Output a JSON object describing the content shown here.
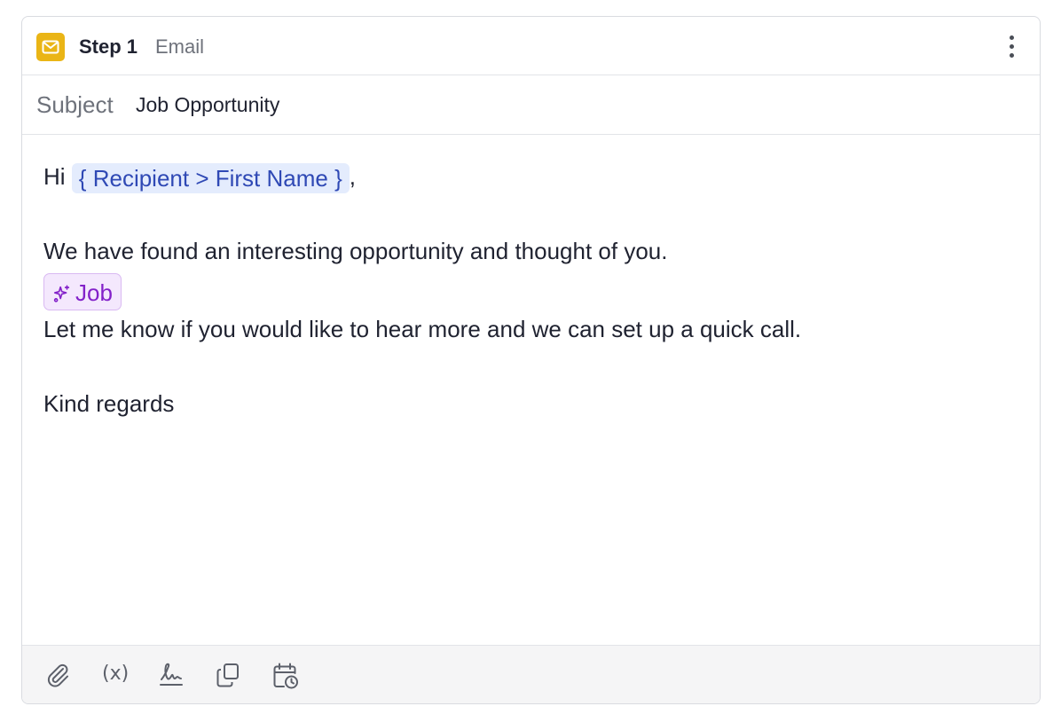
{
  "header": {
    "step_label": "Step 1",
    "step_type": "Email",
    "badge_color": "#eab516",
    "badge_icon": "mail-icon",
    "menu_icon": "more-vertical-icon"
  },
  "subject": {
    "label": "Subject",
    "value": "Job Opportunity"
  },
  "body": {
    "greeting": "Hi",
    "recipient_variable": "{ Recipient > First Name }",
    "greeting_suffix": ",",
    "paragraph1": "We have found an interesting opportunity and thought of you.",
    "ai_snippet": {
      "label": "Job",
      "icon": "sparkles-icon",
      "color": "#8321c9"
    },
    "paragraph2": "Let me know if you would like to hear more and we can set up a quick call.",
    "signoff": "Kind regards"
  },
  "toolbar": {
    "attach_icon": "paperclip-icon",
    "variable_label": "(x)",
    "signature_icon": "signature-icon",
    "templates_icon": "copy-icon",
    "schedule_icon": "calendar-clock-icon"
  },
  "colors": {
    "variable_chip_bg": "#e4ecfd",
    "variable_chip_text": "#2f49b5",
    "ai_chip_bg": "#f4e8fd"
  }
}
